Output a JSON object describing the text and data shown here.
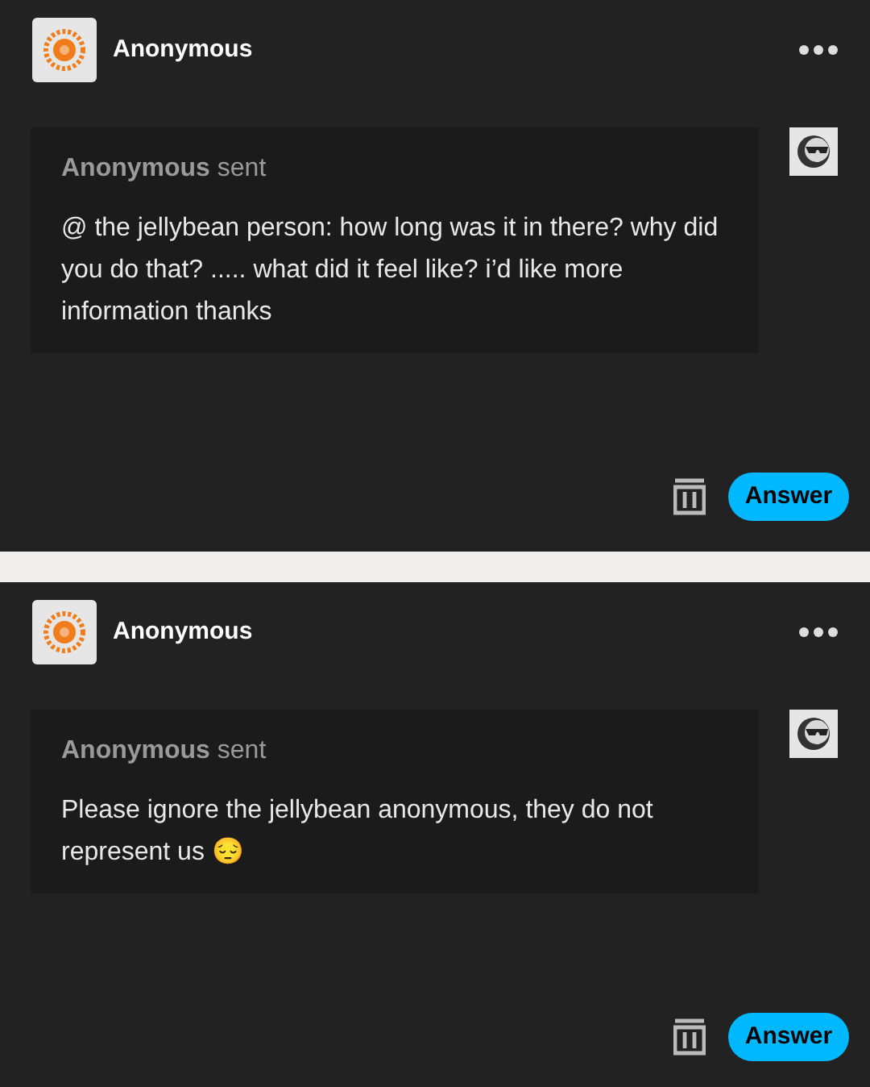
{
  "posts": [
    {
      "author": "Anonymous",
      "sender": "Anonymous",
      "sent_label": "sent",
      "message": "@ the jellybean person: how long was it in there? why did you do that? ..... what did it feel like? i’d like more information thanks",
      "answer_button": "Answer"
    },
    {
      "author": "Anonymous",
      "sender": "Anonymous",
      "sent_label": "sent",
      "message": "Please ignore the jellybean anonymous, they do not represent us 😔",
      "answer_button": "Answer"
    }
  ]
}
